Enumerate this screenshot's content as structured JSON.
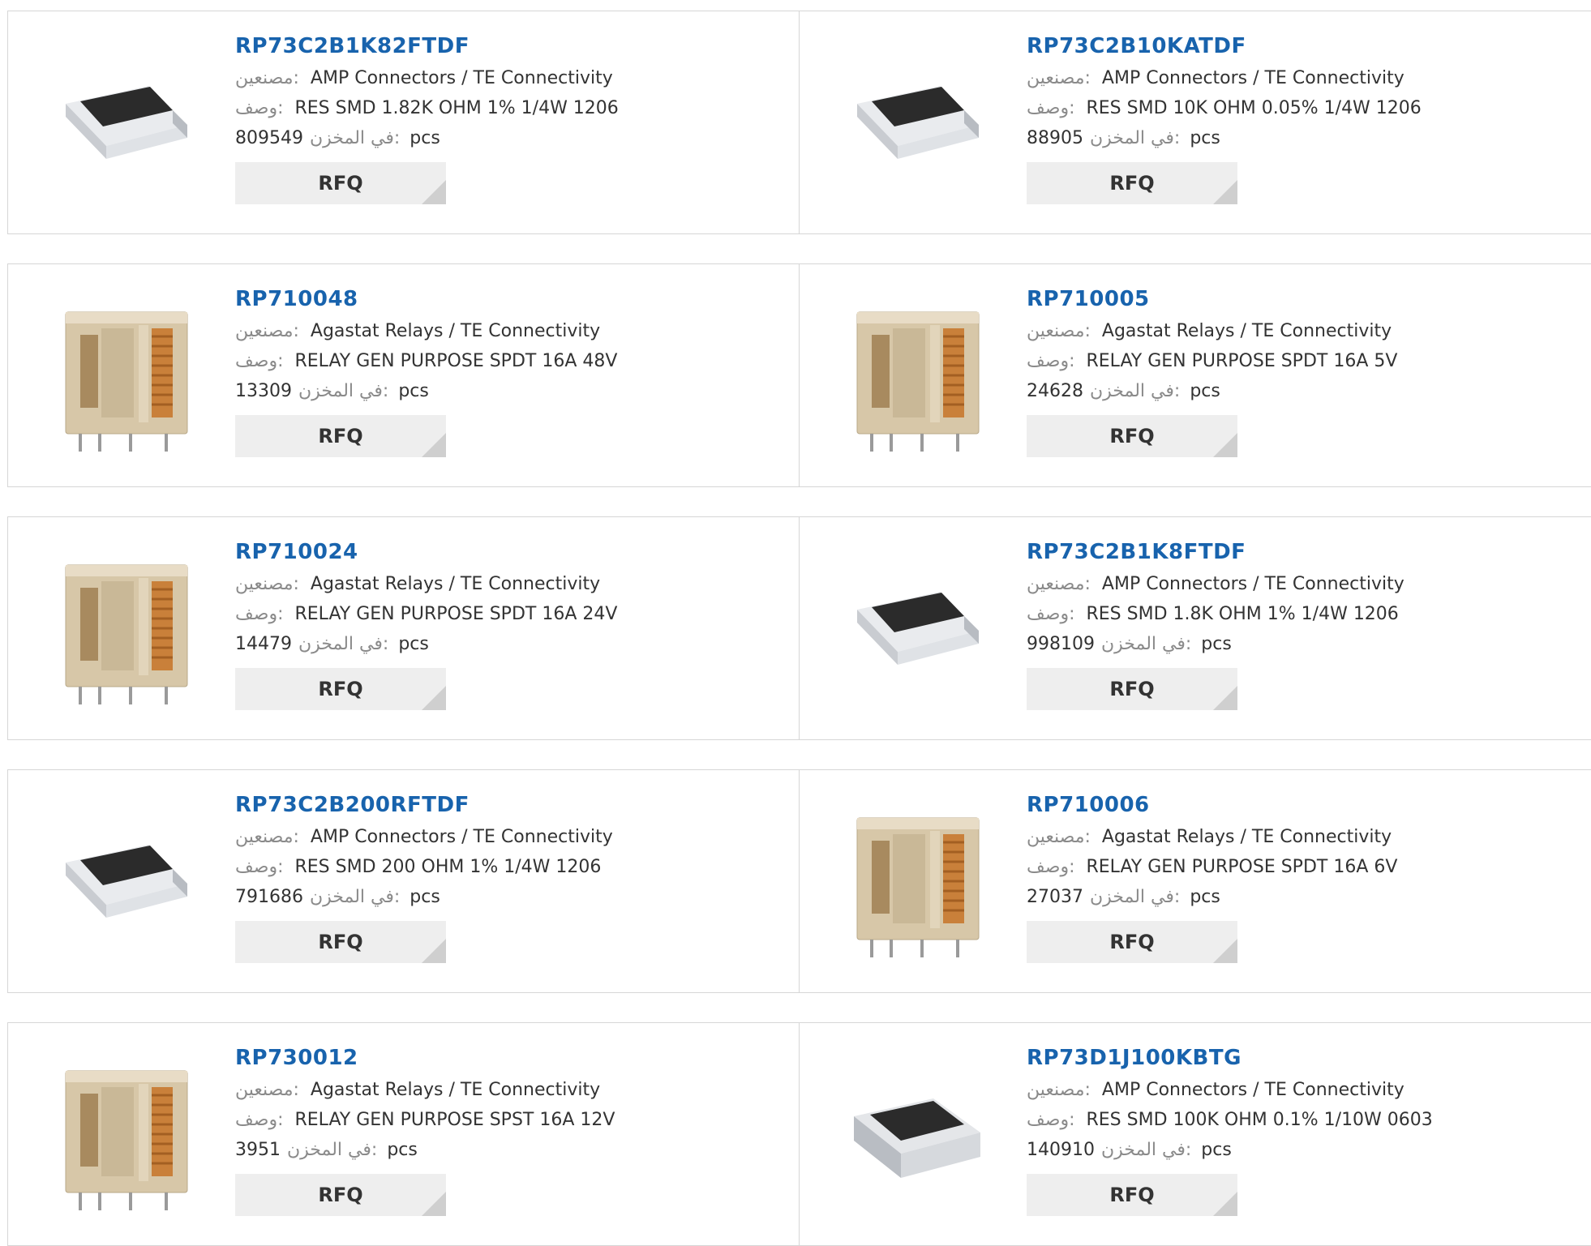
{
  "colors": {
    "part_number": "#1863ad",
    "label": "#8a8a8a",
    "button_bg": "#eeeeee",
    "border": "#d6d6d6"
  },
  "labels": {
    "manufacturer": "مصنعين:",
    "description": "وصف:",
    "in_stock": "في المخزن:",
    "unit": "pcs",
    "rfq": "RFQ"
  },
  "products": [
    {
      "part_number": "RP73C2B1K82FTDF",
      "manufacturer": "AMP Connectors / TE Connectivity",
      "description": "RES SMD 1.82K OHM 1% 1/4W 1206",
      "stock": "809549",
      "image": "chip-resistor"
    },
    {
      "part_number": "RP73C2B10KATDF",
      "manufacturer": "AMP Connectors / TE Connectivity",
      "description": "RES SMD 10K OHM 0.05% 1/4W 1206",
      "stock": "88905",
      "image": "chip-resistor"
    },
    {
      "part_number": "RP710048",
      "manufacturer": "Agastat Relays / TE Connectivity",
      "description": "RELAY GEN PURPOSE SPDT 16A 48V",
      "stock": "13309",
      "image": "relay"
    },
    {
      "part_number": "RP710005",
      "manufacturer": "Agastat Relays / TE Connectivity",
      "description": "RELAY GEN PURPOSE SPDT 16A 5V",
      "stock": "24628",
      "image": "relay"
    },
    {
      "part_number": "RP710024",
      "manufacturer": "Agastat Relays / TE Connectivity",
      "description": "RELAY GEN PURPOSE SPDT 16A 24V",
      "stock": "14479",
      "image": "relay"
    },
    {
      "part_number": "RP73C2B1K8FTDF",
      "manufacturer": "AMP Connectors / TE Connectivity",
      "description": "RES SMD 1.8K OHM 1% 1/4W 1206",
      "stock": "998109",
      "image": "chip-resistor"
    },
    {
      "part_number": "RP73C2B200RFTDF",
      "manufacturer": "AMP Connectors / TE Connectivity",
      "description": "RES SMD 200 OHM 1% 1/4W 1206",
      "stock": "791686",
      "image": "chip-resistor"
    },
    {
      "part_number": "RP710006",
      "manufacturer": "Agastat Relays / TE Connectivity",
      "description": "RELAY GEN PURPOSE SPDT 16A 6V",
      "stock": "27037",
      "image": "relay"
    },
    {
      "part_number": "RP730012",
      "manufacturer": "Agastat Relays / TE Connectivity",
      "description": "RELAY GEN PURPOSE SPST 16A 12V",
      "stock": "3951",
      "image": "relay"
    },
    {
      "part_number": "RP73D1J100KBTG",
      "manufacturer": "AMP Connectors / TE Connectivity",
      "description": "RES SMD 100K OHM 0.1% 1/10W 0603",
      "stock": "140910",
      "image": "chip-resistor-0603"
    }
  ]
}
